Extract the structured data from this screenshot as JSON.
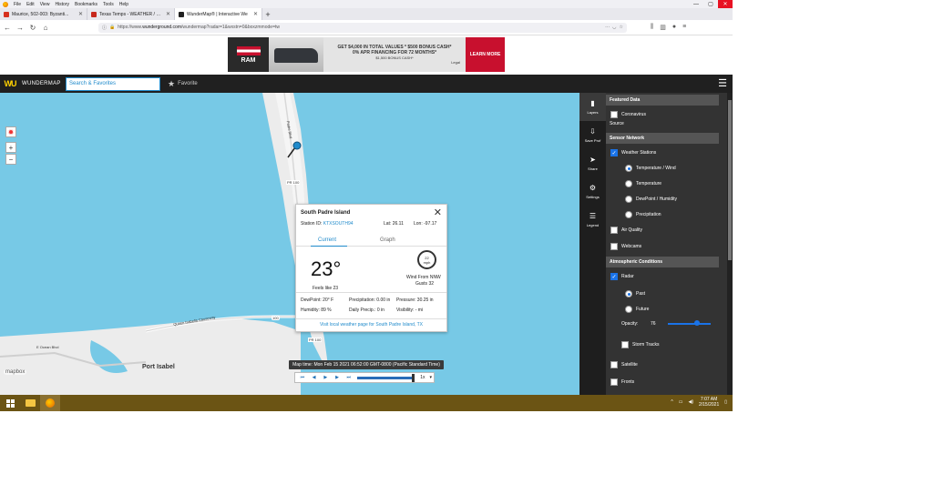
{
  "browser": {
    "menu": [
      "File",
      "Edit",
      "View",
      "History",
      "Bookmarks",
      "Tools",
      "Help"
    ],
    "tabs": [
      {
        "title": "Maurice, 502-003: Byzanti...",
        "color": "#d6301e"
      },
      {
        "title": "Texas Temps - WEATHER / CLI",
        "color": "#c7281d"
      },
      {
        "title": "WunderMap® | Interactive We",
        "color": "#202020"
      }
    ],
    "url_prefix": "https://www.",
    "url_domain": "wunderground.com",
    "url_path": "/wundermap?radar=1&wxstn=0&boxzmmode=tw"
  },
  "ad": {
    "brand": "RAM",
    "headline": "GET $4,000 IN TOTAL VALUES * $500 BONUS CASH*",
    "line2": "0% APR FINANCING FOR 72 MONTHS*",
    "line3": "$1,500 BONUS CASH*",
    "cta": "LEARN MORE",
    "legal": "Legal"
  },
  "header": {
    "logo": "WU",
    "brand": "WUNDERMAP",
    "search_placeholder": "Search & Favorites",
    "favorite": "Favorite"
  },
  "map": {
    "labels": {
      "port_isabel": "Port Isabel",
      "padre_blvd": "Padre Blvd",
      "e_ocean": "E Ocean Blvd",
      "causeway": "Queen Isabella Causeway",
      "pr100a": "PR 100",
      "pr100b": "PR 100",
      "r100": "100",
      "mapbox": "mapbox"
    },
    "zoom_in": "+",
    "zoom_out": "−"
  },
  "popup": {
    "title": "South Padre Island",
    "station_label": "Station ID:",
    "station_id": "KTXSOUTH94",
    "lat": "Lat: 26.11",
    "lon": "Lon: -97.17",
    "tab_current": "Current",
    "tab_graph": "Graph",
    "temp": "23°",
    "feels_like": "Feels like 23",
    "wind_speed": "22",
    "wind_unit": "mph",
    "wind_from": "Wind From NNW",
    "gusts": "Gusts 32",
    "dewpoint": "DewPoint: 20° F",
    "precipitation": "Precipitation: 0.00 in",
    "pressure": "Pressure: 30.25 in",
    "humidity": "Humidity: 89 %",
    "daily_precip": "Daily Precip.: 0 in",
    "visibility": "Visibility: - mi",
    "footer": "Visit local weather page for South Padre Island, TX"
  },
  "timebar": {
    "map_time": "Map time: Mon Feb 15 2021 06:52:00 GMT-0800 (Pacific Standard Time)",
    "speed": "1x",
    "progress": 1.0
  },
  "tools": [
    {
      "label": "Layers",
      "icon": "layers-icon",
      "glyph": "▮"
    },
    {
      "label": "Save Prof",
      "icon": "save-icon",
      "glyph": "⇩"
    },
    {
      "label": "Share",
      "icon": "share-icon",
      "glyph": "➤"
    },
    {
      "label": "Settings",
      "icon": "gear-icon",
      "glyph": "⚙"
    },
    {
      "label": "Legend",
      "icon": "legend-icon",
      "glyph": "☰"
    }
  ],
  "panel": {
    "featured": "Featured Data",
    "coronavirus": "Coronavirus",
    "source": "Source",
    "sensor": "Sensor Network",
    "weather_stations": "Weather Stations",
    "temp_wind": "Temperature / Wind",
    "temperature": "Temperature",
    "dewpoint": "DewPoint / Humidity",
    "precipitation": "Precipitation",
    "air_quality": "Air Quality",
    "webcams": "Webcams",
    "atmospheric": "Atmospheric Conditions",
    "radar": "Radar",
    "past": "Past",
    "future": "Future",
    "opacity_label": "Opacity:",
    "opacity_value": "76",
    "storm_tracks": "Storm Tracks",
    "satellite": "Satellite",
    "fronts": "Fronts"
  },
  "taskbar": {
    "time": "7:07 AM",
    "date": "2/15/2021"
  },
  "colors": {
    "water": "#77c9e6",
    "land": "#ececec",
    "accent": "#1f8acb"
  }
}
